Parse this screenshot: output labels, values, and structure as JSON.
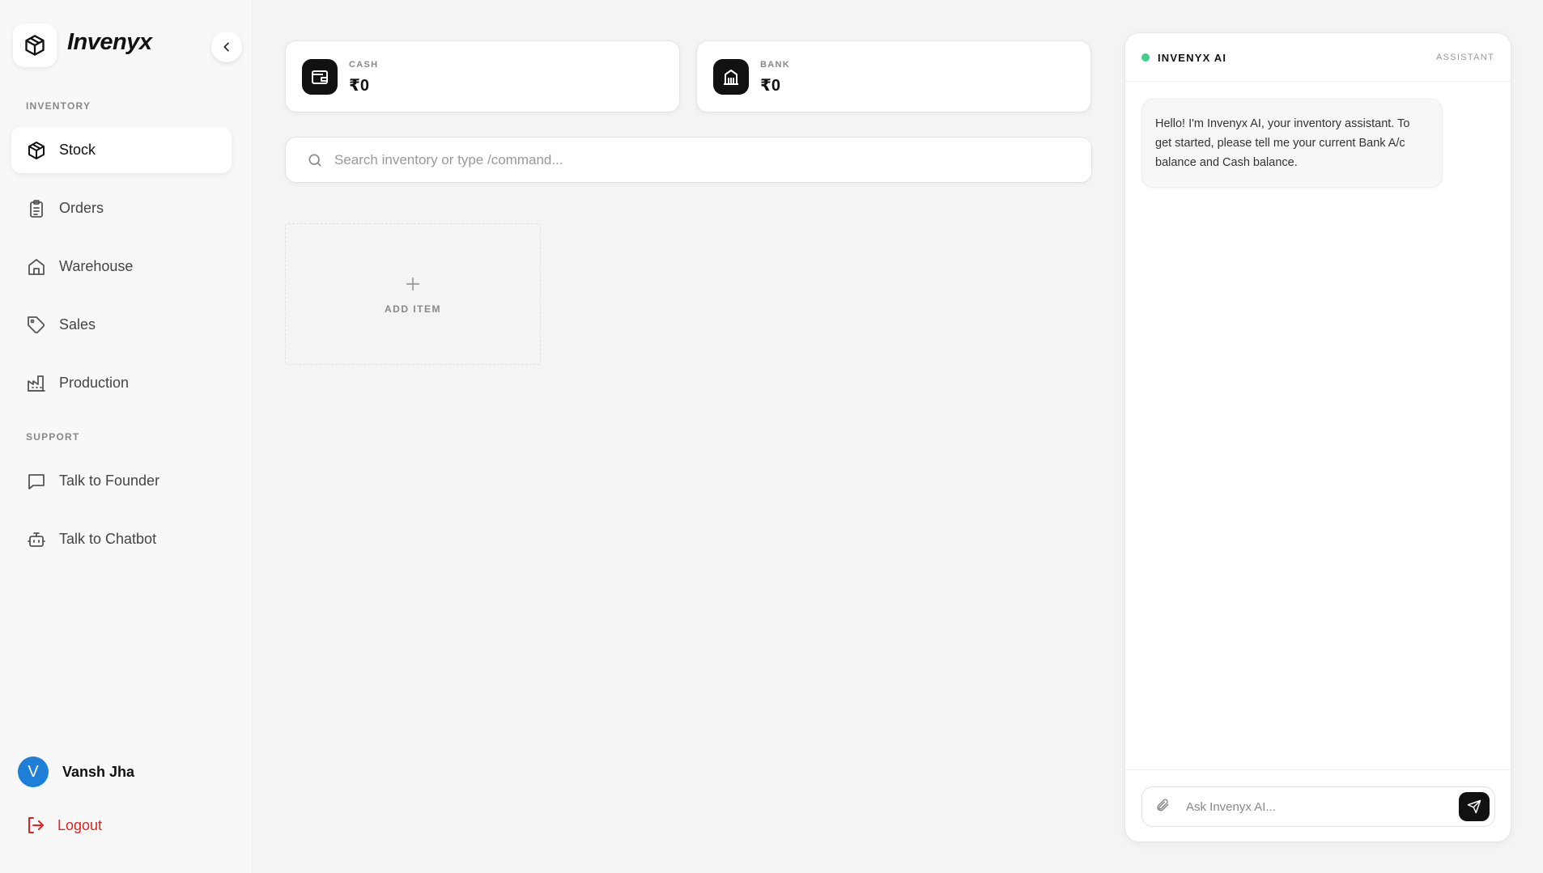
{
  "app": {
    "brand": "Invenyx",
    "logo_icon": "box-icon",
    "collapse_icon": "chevron-left-icon"
  },
  "sidebar": {
    "sections": [
      {
        "label": "INVENTORY",
        "items": [
          {
            "label": "Stock",
            "icon": "box-icon",
            "active": true
          },
          {
            "label": "Orders",
            "icon": "clipboard-list-icon"
          },
          {
            "label": "Warehouse",
            "icon": "home-icon"
          },
          {
            "label": "Sales",
            "icon": "tag-icon"
          },
          {
            "label": "Production",
            "icon": "factory-icon"
          }
        ]
      },
      {
        "label": "SUPPORT",
        "items": [
          {
            "label": "Talk to Founder",
            "icon": "message-square-icon"
          },
          {
            "label": "Talk to Chatbot",
            "icon": "bot-icon"
          }
        ]
      }
    ],
    "user": {
      "initial": "V",
      "name": "Vansh Jha"
    },
    "logout": {
      "label": "Logout",
      "icon": "logout-icon"
    }
  },
  "balances": {
    "cash": {
      "label": "CASH",
      "value": "₹0",
      "icon": "wallet-icon"
    },
    "bank": {
      "label": "BANK",
      "value": "₹0",
      "icon": "bank-icon"
    }
  },
  "search": {
    "placeholder": "Search inventory or type /command...",
    "icon": "search-icon"
  },
  "add_item": {
    "label": "ADD ITEM",
    "icon": "plus-icon"
  },
  "chat": {
    "title": "INVENYX AI",
    "role": "ASSISTANT",
    "status_color": "#3ecf8e",
    "messages": [
      {
        "from": "assistant",
        "text": "Hello! I'm Invenyx AI, your inventory assistant. To get started, please tell me your current Bank A/c balance and Cash balance."
      }
    ],
    "input_placeholder": "Ask Invenyx AI...",
    "attach_icon": "paperclip-icon",
    "send_icon": "send-icon"
  },
  "colors": {
    "accent": "#111111",
    "logout": "#e02424",
    "avatar": "#1e7fd8"
  }
}
